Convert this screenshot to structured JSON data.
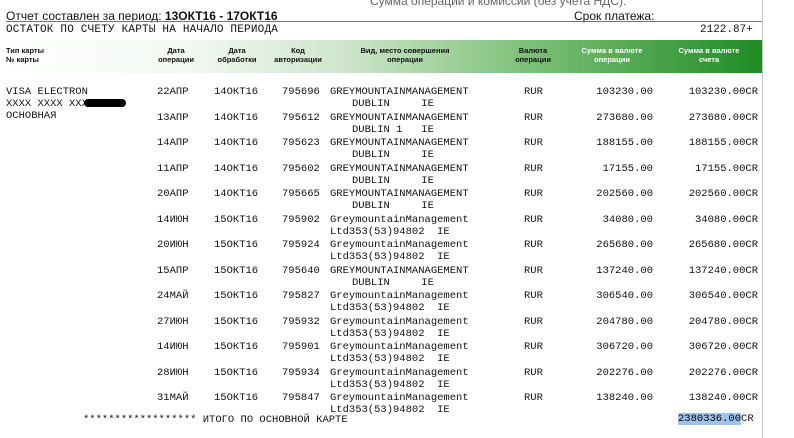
{
  "top_partial_text": "Сумма операций и комиссии (без учета НДС):",
  "report_period_label": "Отчет составлен за период:",
  "report_period_value": "13ОКТ16 - 17ОКТ16",
  "due_label": "Срок платежа:",
  "opening_balance_label": "ОСТАТОК ПО СЧЕТУ КАРТЫ НА НАЧАЛО ПЕРИОДА",
  "opening_balance_value": "2122.87+",
  "columns": {
    "card_type": [
      "Тип карты",
      "№ карты"
    ],
    "op_date": [
      "Дата",
      "операции"
    ],
    "proc_date": [
      "Дата",
      "обработки"
    ],
    "auth_code": [
      "Код",
      "авторизации"
    ],
    "place": [
      "Вид, место совершения",
      "операции"
    ],
    "currency": [
      "Валюта",
      "операции"
    ],
    "amount_op": [
      "Сумма в валюте",
      "операции"
    ],
    "amount_acc": [
      "Сумма в валюте",
      "счета"
    ]
  },
  "card": {
    "line1": "VISA ELECTRON",
    "line2": "XXXX XXXX XXX",
    "line3": "ОСНОВНАЯ"
  },
  "transactions": [
    {
      "op_date": "22АПР",
      "proc_date": "14ОКТ16",
      "auth": "795696",
      "place1": "GREYMOUNTAINMANAGEMENT",
      "place2": "DUBLIN     IE",
      "currency": "RUR",
      "amount_op": "103230.00",
      "amount_acc": "103230.00CR"
    },
    {
      "op_date": "13АПР",
      "proc_date": "14ОКТ16",
      "auth": "795612",
      "place1": "GREYMOUNTAINMANAGEMENT",
      "place2": "DUBLIN 1   IE",
      "currency": "RUR",
      "amount_op": "273680.00",
      "amount_acc": "273680.00CR"
    },
    {
      "op_date": "14АПР",
      "proc_date": "14ОКТ16",
      "auth": "795623",
      "place1": "GREYMOUNTAINMANAGEMENT",
      "place2": "DUBLIN     IE",
      "currency": "RUR",
      "amount_op": "188155.00",
      "amount_acc": "188155.00CR"
    },
    {
      "op_date": "11АПР",
      "proc_date": "14ОКТ16",
      "auth": "795602",
      "place1": "GREYMOUNTAINMANAGEMENT",
      "place2": "DUBLIN     IE",
      "currency": "RUR",
      "amount_op": "17155.00",
      "amount_acc": "17155.00CR"
    },
    {
      "op_date": "20АПР",
      "proc_date": "14ОКТ16",
      "auth": "795665",
      "place1": "GREYMOUNTAINMANAGEMENT",
      "place2": "DUBLIN     IE",
      "currency": "RUR",
      "amount_op": "202560.00",
      "amount_acc": "202560.00CR"
    },
    {
      "op_date": "14ИЮН",
      "proc_date": "15ОКТ16",
      "auth": "795902",
      "place1": "GreymountainManagement",
      "place2": "Ltd353(53)94802  IE",
      "currency": "RUR",
      "amount_op": "34080.00",
      "amount_acc": "34080.00CR"
    },
    {
      "op_date": "20ИЮН",
      "proc_date": "15ОКТ16",
      "auth": "795924",
      "place1": "GreymountainManagement",
      "place2": "Ltd353(53)94802  IE",
      "currency": "RUR",
      "amount_op": "265680.00",
      "amount_acc": "265680.00CR"
    },
    {
      "op_date": "15АПР",
      "proc_date": "15ОКТ16",
      "auth": "795640",
      "place1": "GREYMOUNTAINMANAGEMENT",
      "place2": "DUBLIN     IE",
      "currency": "RUR",
      "amount_op": "137240.00",
      "amount_acc": "137240.00CR"
    },
    {
      "op_date": "24МАЙ",
      "proc_date": "15ОКТ16",
      "auth": "795827",
      "place1": "GreymountainManagement",
      "place2": "Ltd353(53)94802  IE",
      "currency": "RUR",
      "amount_op": "306540.00",
      "amount_acc": "306540.00CR"
    },
    {
      "op_date": "27ИЮН",
      "proc_date": "15ОКТ16",
      "auth": "795932",
      "place1": "GreymountainManagement",
      "place2": "Ltd353(53)94802  IE",
      "currency": "RUR",
      "amount_op": "204780.00",
      "amount_acc": "204780.00CR"
    },
    {
      "op_date": "14ИЮН",
      "proc_date": "15ОКТ16",
      "auth": "795901",
      "place1": "GreymountainManagement",
      "place2": "Ltd353(53)94802  IE",
      "currency": "RUR",
      "amount_op": "306720.00",
      "amount_acc": "306720.00CR"
    },
    {
      "op_date": "28ИЮН",
      "proc_date": "15ОКТ16",
      "auth": "795934",
      "place1": "GreymountainManagement",
      "place2": "Ltd353(53)94802  IE",
      "currency": "RUR",
      "amount_op": "202276.00",
      "amount_acc": "202276.00CR"
    },
    {
      "op_date": "31МАЙ",
      "proc_date": "15ОКТ16",
      "auth": "795847",
      "place1": "GreymountainManagement",
      "place2": "Ltd353(53)94802  IE",
      "currency": "RUR",
      "amount_op": "138240.00",
      "amount_acc": "138240.00CR"
    }
  ],
  "total_label": "****************** ИТОГО ПО ОСНОВНОЙ КАРТЕ",
  "total_value": "2380336.00",
  "total_suffix": "CR",
  "colors": {
    "header_green": "#1f8b23",
    "selection": "#9fc3e8"
  }
}
